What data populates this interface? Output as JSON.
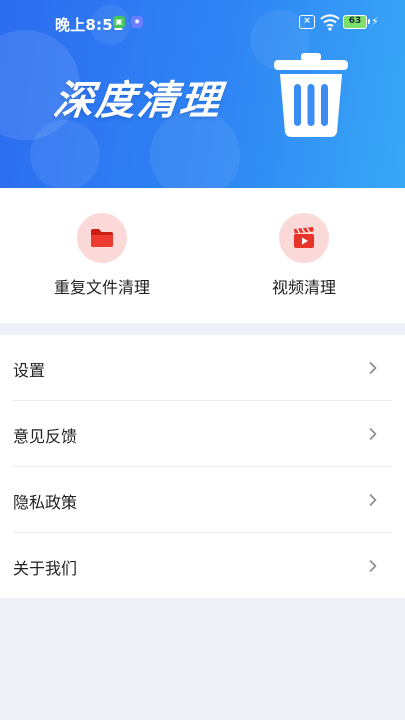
{
  "status_bar": {
    "time": "晚上8:51",
    "battery": "63",
    "icons": [
      "app-notification-icon",
      "app-notification-icon",
      "sim-off-icon",
      "wifi-icon",
      "battery-icon",
      "charging-bolt-icon"
    ]
  },
  "hero": {
    "title": "深度清理",
    "icon": "trash-can-icon",
    "gradient": [
      "#2c6cf0",
      "#38a8f6"
    ]
  },
  "shortcuts": [
    {
      "label": "重复文件清理",
      "icon": "folder-icon",
      "icon_color": "#e8332a",
      "bg": "#fcd9d9"
    },
    {
      "label": "视频清理",
      "icon": "video-clapper-icon",
      "icon_color": "#e8332a",
      "bg": "#fcd9d9"
    }
  ],
  "menu": [
    {
      "label": "设置",
      "icon": "chevron-right-icon"
    },
    {
      "label": "意见反馈",
      "icon": "chevron-right-icon"
    },
    {
      "label": "隐私政策",
      "icon": "chevron-right-icon"
    },
    {
      "label": "关于我们",
      "icon": "chevron-right-icon"
    }
  ]
}
